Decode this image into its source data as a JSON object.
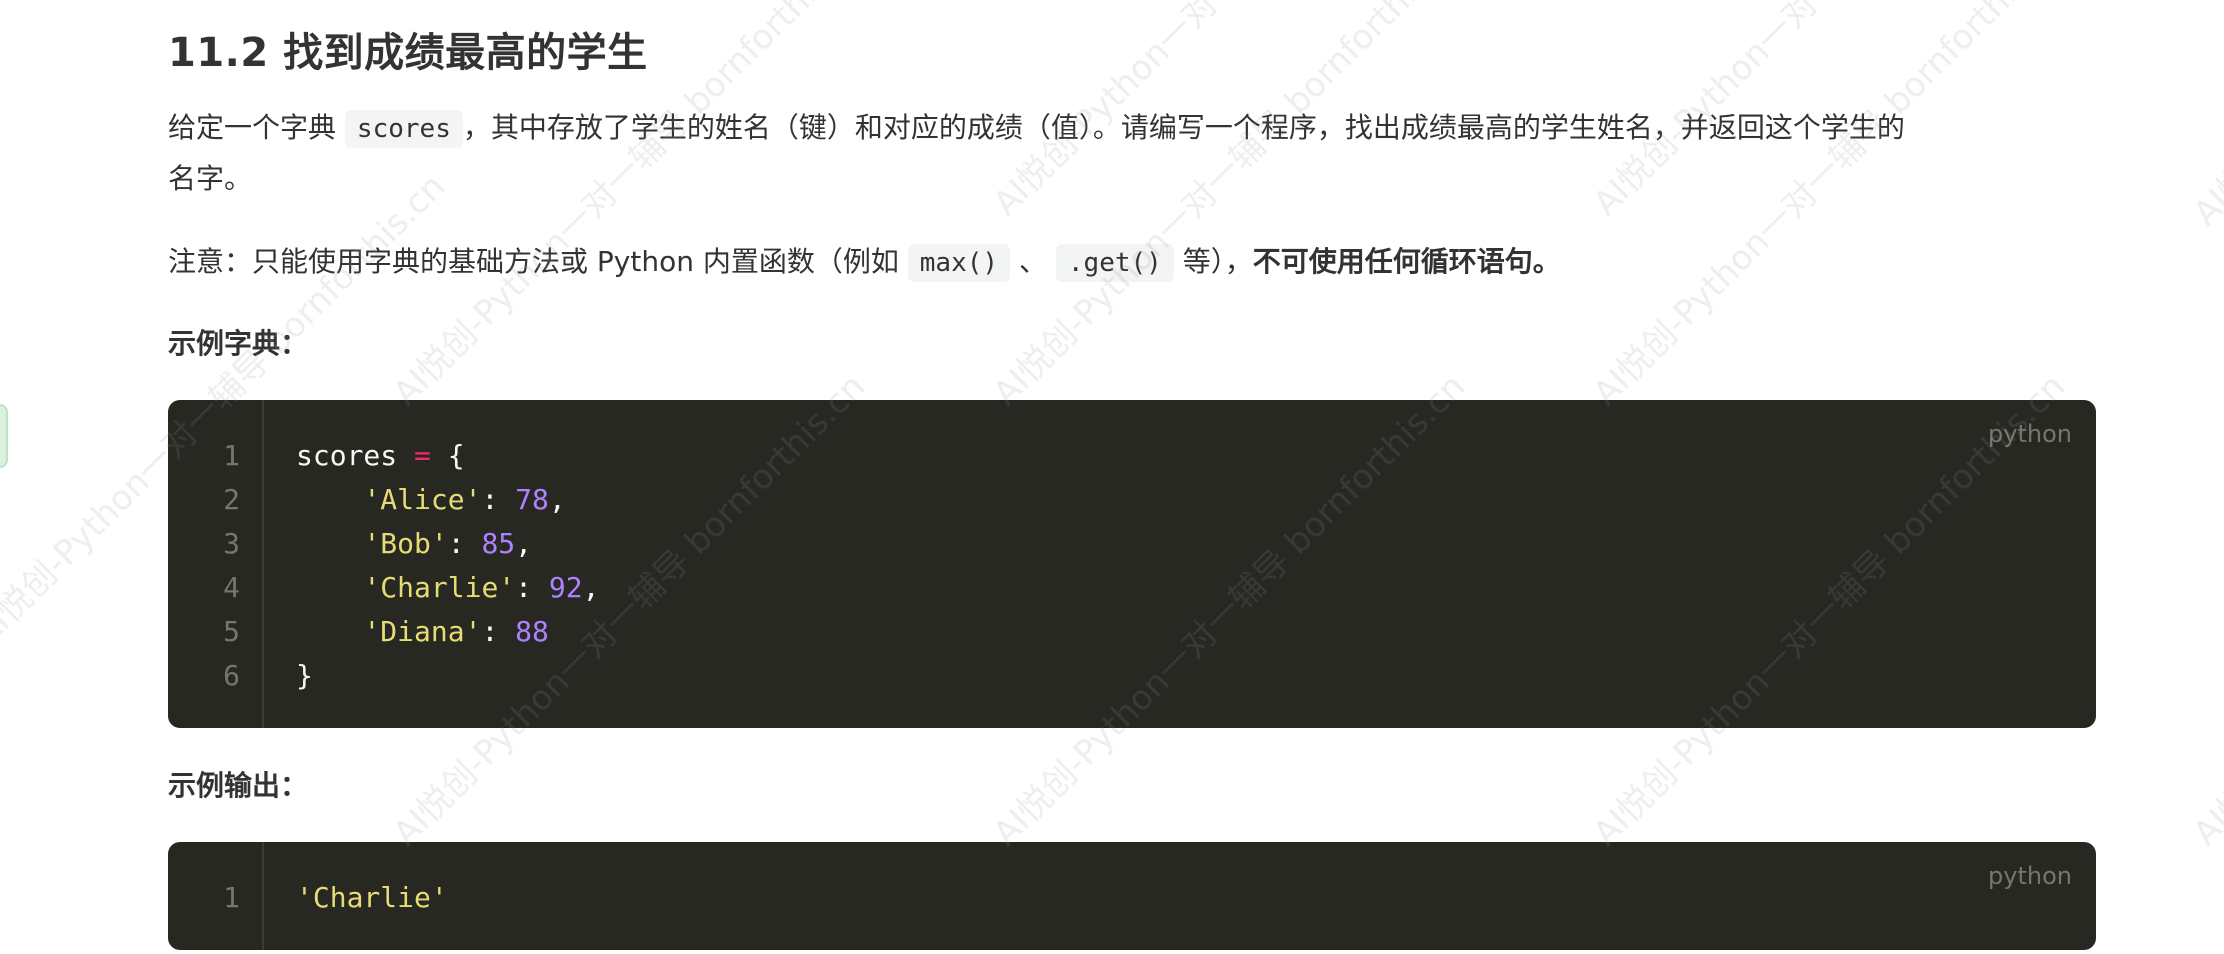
{
  "heading": "11.2 找到成绩最高的学生",
  "para1": {
    "before": "给定一个字典",
    "code": "scores",
    "after_line1": "，其中存放了学生的姓名（键）和对应的成绩（值）。请编写一个程序，找出成绩最高的学生姓名，并返回这个学生的",
    "after_line2": "名字。"
  },
  "para2": {
    "prefix": "注意：只能使用字典的基础方法或 Python 内置函数（例如",
    "code1": "max()",
    "sep": "、",
    "code2": ".get()",
    "suffix": "等），",
    "bold": "不可使用任何循环语句。"
  },
  "example_dict_label": "示例字典：",
  "example_output_label": "示例输出：",
  "code_block_1": {
    "language": "python",
    "lines": [
      {
        "num": "1",
        "tokens": [
          {
            "t": "scores ",
            "c": "pun"
          },
          {
            "t": "=",
            "c": "op"
          },
          {
            "t": " {",
            "c": "pun"
          }
        ]
      },
      {
        "num": "2",
        "tokens": [
          {
            "t": "    ",
            "c": "pun"
          },
          {
            "t": "'Alice'",
            "c": "str"
          },
          {
            "t": ": ",
            "c": "pun"
          },
          {
            "t": "78",
            "c": "num"
          },
          {
            "t": ",",
            "c": "pun"
          }
        ]
      },
      {
        "num": "3",
        "tokens": [
          {
            "t": "    ",
            "c": "pun"
          },
          {
            "t": "'Bob'",
            "c": "str"
          },
          {
            "t": ": ",
            "c": "pun"
          },
          {
            "t": "85",
            "c": "num"
          },
          {
            "t": ",",
            "c": "pun"
          }
        ]
      },
      {
        "num": "4",
        "tokens": [
          {
            "t": "    ",
            "c": "pun"
          },
          {
            "t": "'Charlie'",
            "c": "str"
          },
          {
            "t": ": ",
            "c": "pun"
          },
          {
            "t": "92",
            "c": "num"
          },
          {
            "t": ",",
            "c": "pun"
          }
        ]
      },
      {
        "num": "5",
        "tokens": [
          {
            "t": "    ",
            "c": "pun"
          },
          {
            "t": "'Diana'",
            "c": "str"
          },
          {
            "t": ": ",
            "c": "pun"
          },
          {
            "t": "88",
            "c": "num"
          }
        ]
      },
      {
        "num": "6",
        "tokens": [
          {
            "t": "}",
            "c": "pun"
          }
        ]
      }
    ]
  },
  "code_block_2": {
    "language": "python",
    "lines": [
      {
        "num": "1",
        "tokens": [
          {
            "t": "'Charlie'",
            "c": "str"
          }
        ]
      }
    ]
  },
  "watermark_text": "AI悦创-Python一对一辅导 bornforthis.cn",
  "colors": {
    "code_bg": "#272822",
    "string": "#e6db74",
    "number": "#ae81ff",
    "operator": "#f92672",
    "line_number": "#75766f"
  }
}
